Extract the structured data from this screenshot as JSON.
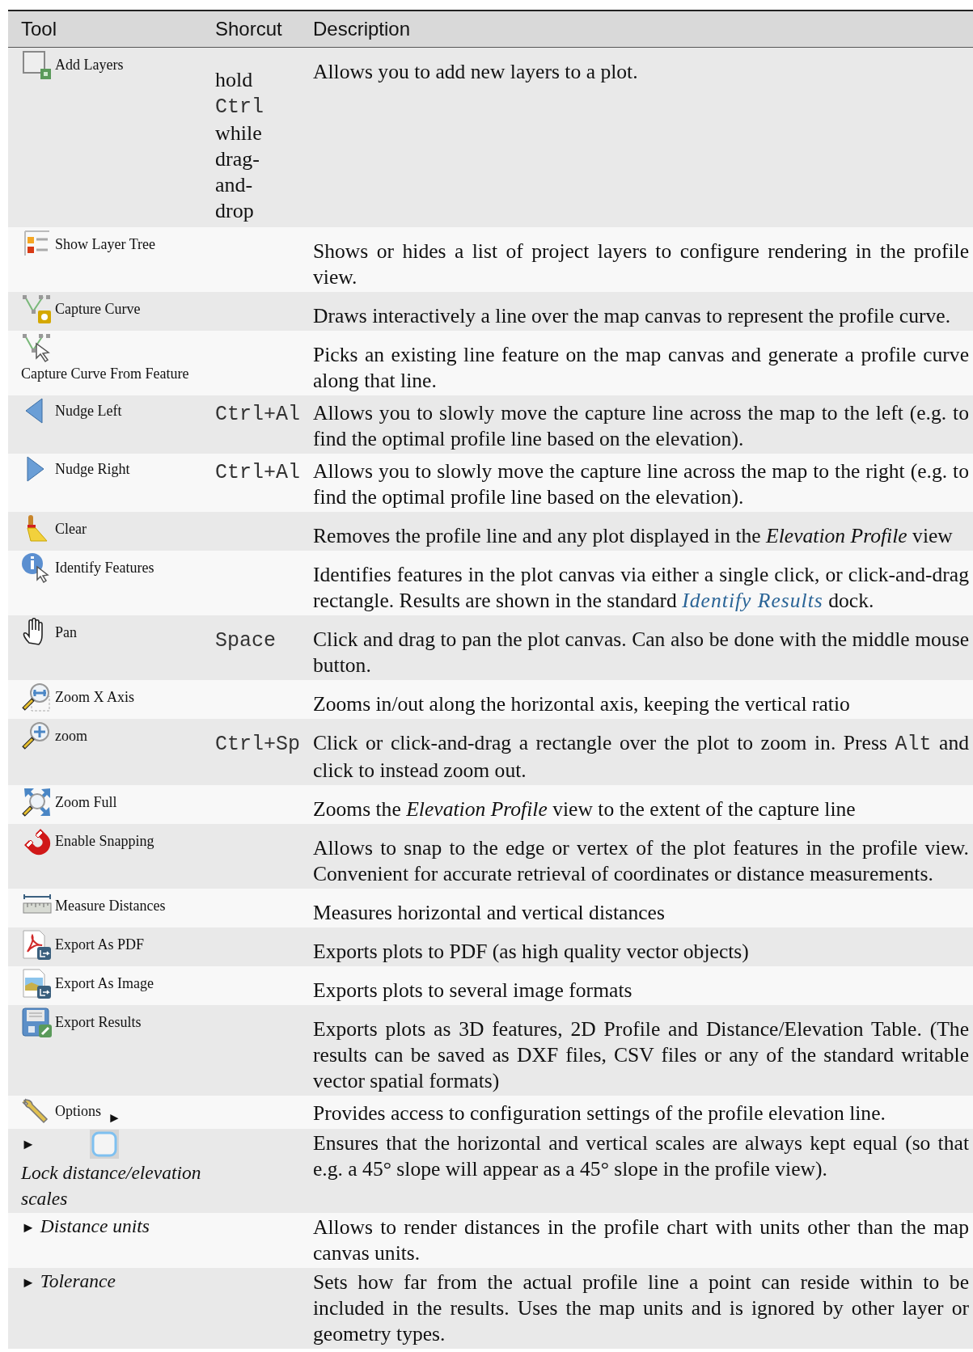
{
  "table": {
    "columns": [
      "Tool",
      "Shorcut",
      "Description"
    ],
    "rows": [
      {
        "tool": {
          "kind": "add-layers",
          "label": "Add Layers"
        },
        "shortcut": [
          {
            "kind": "text",
            "text": "hold"
          },
          {
            "kind": "code",
            "text": "Ctrl"
          },
          {
            "kind": "text",
            "text": "while drag-and-drop"
          }
        ],
        "description": [
          {
            "kind": "text",
            "text": "Allows you to add new layers to a plot."
          }
        ]
      },
      {
        "tool": {
          "kind": "layer-tree",
          "label": "Show Layer Tree"
        },
        "description": [
          {
            "kind": "text",
            "text": "Shows or hides a list of project layers to configure rendering in the profile view."
          }
        ]
      },
      {
        "tool": {
          "kind": "capture-curve",
          "label": "Capture Curve"
        },
        "description": [
          {
            "kind": "text",
            "text": "Draws interactively a line over the map canvas to represent the profile curve."
          }
        ]
      },
      {
        "tool": {
          "kind": "capture-feature",
          "label": "Capture Curve From Feature"
        },
        "description": [
          {
            "kind": "text",
            "text": "Picks an existing line feature on the map canvas and generate a profile curve along that line."
          }
        ]
      },
      {
        "tool": {
          "kind": "nudge-left",
          "label": "Nudge Left"
        },
        "shortcut": [
          {
            "kind": "code",
            "text": "Ctrl+Al"
          }
        ],
        "description": [
          {
            "kind": "text",
            "text": "Allows you to slowly move the capture line across the map to the left (e.g. to find the optimal profile line based on the elevation)."
          }
        ]
      },
      {
        "tool": {
          "kind": "nudge-right",
          "label": "Nudge Right"
        },
        "shortcut": [
          {
            "kind": "code",
            "text": "Ctrl+Al"
          }
        ],
        "description": [
          {
            "kind": "text",
            "text": "Allows you to slowly move the capture line across the map to the right (e.g. to find the optimal profile line based on the elevation)."
          }
        ]
      },
      {
        "tool": {
          "kind": "clear",
          "label": "Clear"
        },
        "description": [
          {
            "kind": "text",
            "text": "Removes the profile line and any plot displayed in the *Elevation Profile* view"
          }
        ]
      },
      {
        "tool": {
          "kind": "identify",
          "label": "Identify Features"
        },
        "description": [
          {
            "kind": "text",
            "text": "Identifies features in the plot canvas via either a single click, or click-and-drag rectangle. Results are shown in the standard "
          },
          {
            "kind": "link",
            "text": "Identify Results"
          },
          {
            "kind": "text",
            "text": " dock."
          }
        ]
      },
      {
        "tool": {
          "kind": "pan",
          "label": "Pan"
        },
        "shortcut": [
          {
            "kind": "code",
            "text": "Space"
          }
        ],
        "description": [
          {
            "kind": "text",
            "text": "Click and drag to pan the plot canvas. Can also be done with the middle mouse button."
          }
        ]
      },
      {
        "tool": {
          "kind": "zoom-x",
          "label": "Zoom X Axis"
        },
        "description": [
          {
            "kind": "text",
            "text": "Zooms in/out along the horizontal axis, keeping the vertical ratio"
          }
        ]
      },
      {
        "tool": {
          "kind": "zoom",
          "label": "zoom"
        },
        "shortcut": [
          {
            "kind": "code",
            "text": "Ctrl+Sp"
          }
        ],
        "description": [
          {
            "kind": "text",
            "text": "Click or click-and-drag a rectangle over the plot to zoom in. Press "
          },
          {
            "kind": "code",
            "text": "Alt"
          },
          {
            "kind": "text",
            "text": " and click to instead zoom out."
          }
        ]
      },
      {
        "tool": {
          "kind": "zoom-full",
          "label": "Zoom Full"
        },
        "description": [
          {
            "kind": "text",
            "text": "Zooms the *Elevation Profile* view to the extent of the capture line"
          }
        ]
      },
      {
        "tool": {
          "kind": "snapping",
          "label": "Enable Snapping"
        },
        "description": [
          {
            "kind": "text",
            "text": "Allows to snap to the edge or vertex of the plot features in the profile view. Convenient for accurate retrieval of coordinates or distance measurements."
          }
        ]
      },
      {
        "tool": {
          "kind": "measure",
          "label": "Measure Distances"
        },
        "description": [
          {
            "kind": "text",
            "text": "Measures horizontal and vertical distances"
          }
        ]
      },
      {
        "tool": {
          "kind": "export-pdf",
          "label": "Export As PDF"
        },
        "description": [
          {
            "kind": "text",
            "text": "Exports plots to PDF (as high quality vector objects)"
          }
        ]
      },
      {
        "tool": {
          "kind": "export-image",
          "label": "Export As Image"
        },
        "description": [
          {
            "kind": "text",
            "text": "Exports plots to several image formats"
          }
        ]
      },
      {
        "tool": {
          "kind": "export-results",
          "label": "Export Results"
        },
        "description": [
          {
            "kind": "text",
            "text": "Exports plots as 3D features, 2D Profile and Distance/Elevation Table. (The results can be saved as DXF files, CSV files or any of the standard writable vector spatial formats)"
          }
        ]
      },
      {
        "tool": {
          "kind": "options",
          "label": "Options",
          "after": "►"
        },
        "description": [
          {
            "kind": "text",
            "text": "Provides access to configuration settings of the profile elevation line."
          }
        ]
      },
      {
        "tool": {
          "kind": "checkbox",
          "before": "►",
          "label": "Lock distance/elevation scales",
          "italic": true
        },
        "description": [
          {
            "kind": "text",
            "text": "Ensures that the horizontal and vertical scales are always kept equal (so that e.g. a 45° slope will appear as a 45° slope in the profile view)."
          }
        ]
      },
      {
        "tool": {
          "before": "►",
          "label": "Distance units",
          "italic": true
        },
        "description": [
          {
            "kind": "text",
            "text": "Allows to render distances in the profile chart with units other than the map canvas units."
          }
        ]
      },
      {
        "tool": {
          "before": "►",
          "label": "Tolerance",
          "italic": true
        },
        "description": [
          {
            "kind": "text",
            "text": "Sets how far from the actual profile line a point can reside within to be included in the results. Uses the map units and is ignored by other layer or geometry types."
          }
        ]
      }
    ]
  }
}
